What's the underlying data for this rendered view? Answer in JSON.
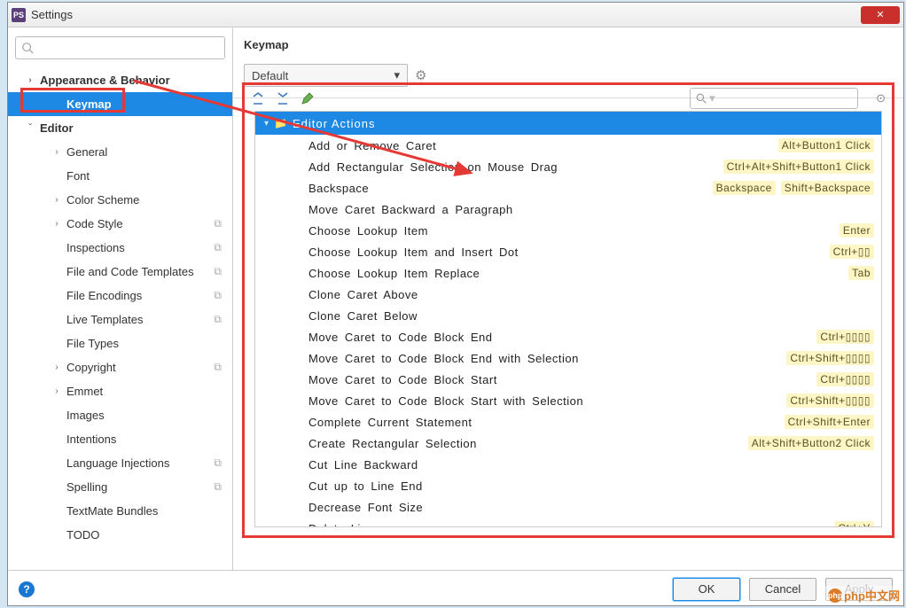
{
  "window": {
    "title": "Settings",
    "icon_label": "PS"
  },
  "sidebar": {
    "search_placeholder": "",
    "items": [
      {
        "label": "Appearance & Behavior",
        "level": 1,
        "chevron": "›",
        "bold": true
      },
      {
        "label": "Keymap",
        "level": 2,
        "chevron": "",
        "bold": true,
        "selected": true
      },
      {
        "label": "Editor",
        "level": 1,
        "chevron": "ˇ",
        "bold": true
      },
      {
        "label": "General",
        "level": 2,
        "chevron": "›"
      },
      {
        "label": "Font",
        "level": 2,
        "chevron": ""
      },
      {
        "label": "Color Scheme",
        "level": 2,
        "chevron": "›"
      },
      {
        "label": "Code Style",
        "level": 2,
        "chevron": "›",
        "copy": true
      },
      {
        "label": "Inspections",
        "level": 2,
        "chevron": "",
        "copy": true
      },
      {
        "label": "File and Code Templates",
        "level": 2,
        "chevron": "",
        "copy": true
      },
      {
        "label": "File Encodings",
        "level": 2,
        "chevron": "",
        "copy": true
      },
      {
        "label": "Live Templates",
        "level": 2,
        "chevron": "",
        "copy": true
      },
      {
        "label": "File Types",
        "level": 2,
        "chevron": ""
      },
      {
        "label": "Copyright",
        "level": 2,
        "chevron": "›",
        "copy": true
      },
      {
        "label": "Emmet",
        "level": 2,
        "chevron": "›"
      },
      {
        "label": "Images",
        "level": 2,
        "chevron": ""
      },
      {
        "label": "Intentions",
        "level": 2,
        "chevron": ""
      },
      {
        "label": "Language Injections",
        "level": 2,
        "chevron": "",
        "copy": true
      },
      {
        "label": "Spelling",
        "level": 2,
        "chevron": "",
        "copy": true
      },
      {
        "label": "TextMate Bundles",
        "level": 2,
        "chevron": ""
      },
      {
        "label": "TODO",
        "level": 2,
        "chevron": ""
      }
    ]
  },
  "main": {
    "title": "Keymap",
    "scheme": "Default",
    "group_header": "Editor Actions",
    "filter_placeholder": "",
    "actions": [
      {
        "name": "Add or Remove Caret",
        "sc": [
          "Alt+Button1 Click"
        ]
      },
      {
        "name": "Add Rectangular Selection on Mouse Drag",
        "sc": [
          "Ctrl+Alt+Shift+Button1 Click"
        ]
      },
      {
        "name": "Backspace",
        "sc": [
          "Backspace",
          "Shift+Backspace"
        ]
      },
      {
        "name": "Move Caret Backward a Paragraph",
        "sc": []
      },
      {
        "name": "Choose Lookup Item",
        "sc": [
          "Enter"
        ]
      },
      {
        "name": "Choose Lookup Item and Insert Dot",
        "sc": [
          "Ctrl+▯▯"
        ]
      },
      {
        "name": "Choose Lookup Item Replace",
        "sc": [
          "Tab"
        ]
      },
      {
        "name": "Clone Caret Above",
        "sc": []
      },
      {
        "name": "Clone Caret Below",
        "sc": []
      },
      {
        "name": "Move Caret to Code Block End",
        "sc": [
          "Ctrl+▯▯▯▯"
        ]
      },
      {
        "name": "Move Caret to Code Block End with Selection",
        "sc": [
          "Ctrl+Shift+▯▯▯▯"
        ]
      },
      {
        "name": "Move Caret to Code Block Start",
        "sc": [
          "Ctrl+▯▯▯▯"
        ]
      },
      {
        "name": "Move Caret to Code Block Start with Selection",
        "sc": [
          "Ctrl+Shift+▯▯▯▯"
        ]
      },
      {
        "name": "Complete Current Statement",
        "sc": [
          "Ctrl+Shift+Enter"
        ]
      },
      {
        "name": "Create Rectangular Selection",
        "sc": [
          "Alt+Shift+Button2 Click"
        ]
      },
      {
        "name": "Cut Line Backward",
        "sc": []
      },
      {
        "name": "Cut up to Line End",
        "sc": []
      },
      {
        "name": "Decrease Font Size",
        "sc": []
      },
      {
        "name": "Delete Line",
        "sc": [
          "Ctrl+Y"
        ]
      }
    ]
  },
  "footer": {
    "ok": "OK",
    "cancel": "Cancel",
    "apply": "Apply"
  },
  "watermark": "php中文网"
}
